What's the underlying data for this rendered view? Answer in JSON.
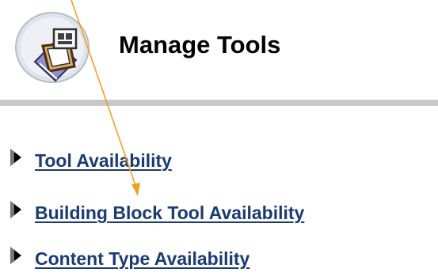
{
  "header": {
    "title": "Manage Tools",
    "icon": "tools-panel-icon"
  },
  "tools": [
    {
      "label": "Tool Availability",
      "icon": "triangle-bullet-icon"
    },
    {
      "label": "Building Block Tool Availability",
      "icon": "triangle-bullet-icon"
    },
    {
      "label": "Content Type Availability",
      "icon": "triangle-bullet-icon"
    }
  ],
  "colors": {
    "link": "#1a3a73",
    "divider": "#c8c8c8",
    "pointer": "#f0a020"
  }
}
